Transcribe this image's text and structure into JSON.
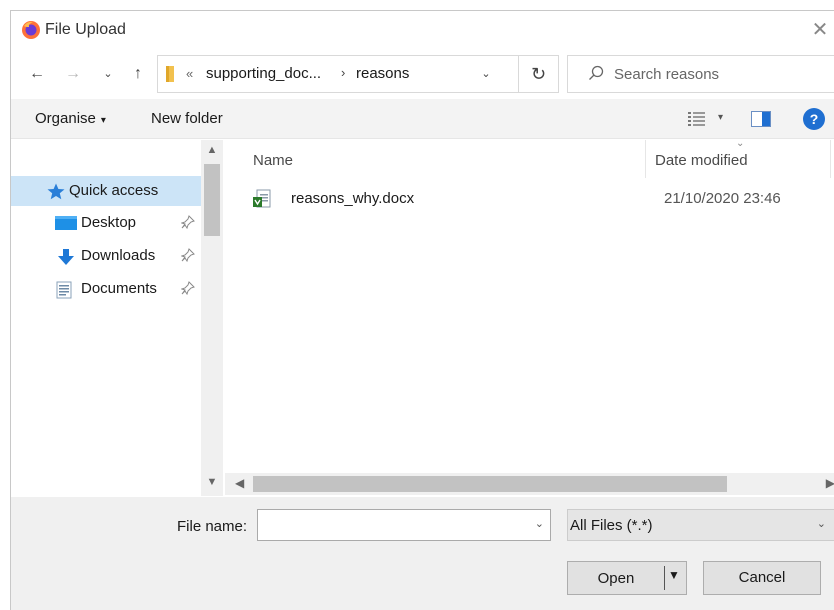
{
  "window": {
    "title": "File Upload",
    "close_glyph": "✕",
    "app_icon": "firefox-icon"
  },
  "nav": {
    "back_glyph": "←",
    "forward_glyph": "→",
    "recent_glyph": "⌄",
    "up_glyph": "↑",
    "refresh_glyph": "↻"
  },
  "address": {
    "overflow_glyph": "«",
    "crumbs": [
      "supporting_doc...",
      "reasons"
    ],
    "separator": "›",
    "dropdown_glyph": "⌄"
  },
  "search": {
    "placeholder": "Search reasons"
  },
  "toolbar": {
    "organise_label": "Organise",
    "organise_caret": "▾",
    "new_folder_label": "New folder",
    "view_caret": "▾",
    "help_label": "?"
  },
  "sidebar": {
    "items": [
      {
        "label": "Quick access",
        "icon": "star-icon",
        "pinned": false,
        "selected": true
      },
      {
        "label": "Desktop",
        "icon": "desktop-folder-icon",
        "pinned": true
      },
      {
        "label": "Downloads",
        "icon": "download-arrow-icon",
        "pinned": true
      },
      {
        "label": "Documents",
        "icon": "documents-icon",
        "pinned": true
      }
    ],
    "pin_glyph": "📌"
  },
  "columns": {
    "name": "Name",
    "date_modified": "Date modified"
  },
  "files": [
    {
      "name": "reasons_why.docx",
      "date_modified": "21/10/2020 23:46",
      "icon": "word-document-icon"
    }
  ],
  "footer": {
    "file_name_label": "File name:",
    "file_name_value": "",
    "filter_label": "All Files (*.*)",
    "open_label": "Open",
    "cancel_label": "Cancel"
  },
  "colors": {
    "selection": "#cce4f7",
    "accent": "#1f6fd1",
    "toolbar_bg": "#f3f3f3",
    "footer_bg": "#f0f0f0"
  }
}
